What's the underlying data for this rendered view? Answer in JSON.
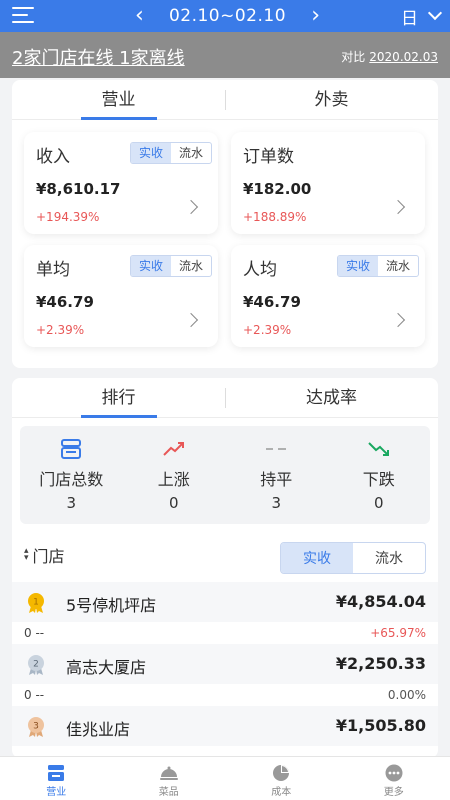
{
  "header": {
    "date_range": "02.10~02.10",
    "period": "日"
  },
  "status": {
    "summary": "2家门店在线 1家离线",
    "compare_label": "对比",
    "compare_date": "2020.02.03"
  },
  "business_tabs": [
    "营业",
    "外卖"
  ],
  "metrics": [
    {
      "title": "收入",
      "value": "¥8,610.17",
      "delta": "+194.39%",
      "toggle": [
        "实收",
        "流水"
      ]
    },
    {
      "title": "订单数",
      "value": "¥182.00",
      "delta": "+188.89%"
    },
    {
      "title": "单均",
      "value": "¥46.79",
      "delta": "+2.39%",
      "toggle": [
        "实收",
        "流水"
      ]
    },
    {
      "title": "人均",
      "value": "¥46.79",
      "delta": "+2.39%",
      "toggle": [
        "实收",
        "流水"
      ]
    }
  ],
  "ranking_tabs": [
    "排行",
    "达成率"
  ],
  "stats": [
    {
      "label": "门店总数",
      "value": "3",
      "icon": "store-icon"
    },
    {
      "label": "上涨",
      "value": "0",
      "icon": "trend-up-icon"
    },
    {
      "label": "持平",
      "value": "3",
      "icon": "flat-dash-icon"
    },
    {
      "label": "下跌",
      "value": "0",
      "icon": "trend-down-icon"
    }
  ],
  "store_section": {
    "title": "门店",
    "toggle": [
      "实收",
      "流水"
    ]
  },
  "stores": [
    {
      "rank": "1",
      "name": "5号停机坪店",
      "amount": "¥4,854.04",
      "sub": "0 --",
      "pct": "+65.97%"
    },
    {
      "rank": "2",
      "name": "高志大厦店",
      "amount": "¥2,250.33",
      "sub": "0 --",
      "pct": "0.00%"
    },
    {
      "rank": "3",
      "name": "佳兆业店",
      "amount": "¥1,505.80"
    }
  ],
  "colors": {
    "primary": "#3a7be8",
    "up": "#e85757",
    "down": "#1aa860",
    "gold": "#f5b800",
    "silver": "#a9b7c6",
    "bronze": "#e0a878"
  },
  "nav": [
    {
      "label": "营业",
      "icon": "store-icon"
    },
    {
      "label": "菜品",
      "icon": "dish-cover-icon"
    },
    {
      "label": "成本",
      "icon": "pie-chart-icon"
    },
    {
      "label": "更多",
      "icon": "more-icon"
    }
  ]
}
